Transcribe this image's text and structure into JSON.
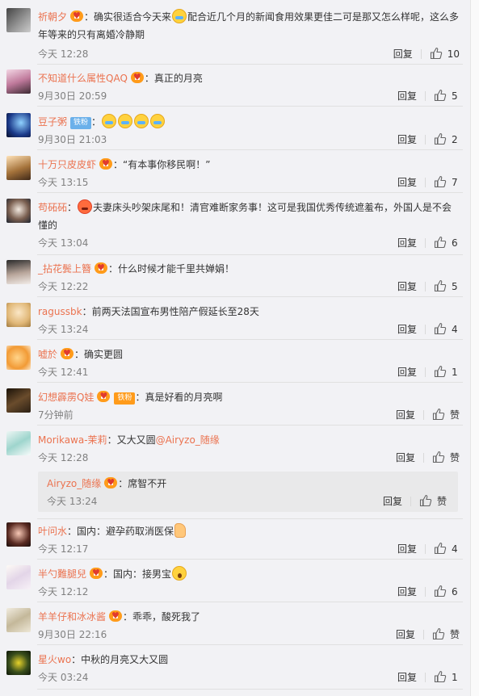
{
  "ui": {
    "reply_label": "回复",
    "like_zero_label": "赞"
  },
  "comments": [
    {
      "user": "祈朝夕",
      "text1": "：确实很适合今天来",
      "text2": "配合近几个月的新闻食用效果更佳二可是那又怎么样呢，这么多年等来的只有离婚冷静期",
      "time": "今天 12:28",
      "likes": "10"
    },
    {
      "user": "不知道什么属性QAQ",
      "text1": "：真正的月亮",
      "time": "9月30日 20:59",
      "likes": "5"
    },
    {
      "user": "豆子粥",
      "badge": "铁粉",
      "text1": "：",
      "time": "9月30日 21:03",
      "likes": "2"
    },
    {
      "user": "十万只皮皮虾",
      "text1": "：“有本事你移民啊！”",
      "time": "今天 13:15",
      "likes": "7"
    },
    {
      "user": "苟砳砳",
      "text1": "：",
      "text2": "夫妻床头吵架床尾和！清官难断家务事！这可是我国优秀传统遮羞布，外国人是不会懂的",
      "time": "今天 13:04",
      "likes": "6"
    },
    {
      "user": "_拈花鬓上簪",
      "text1": "：什么时候才能千里共婵娟！",
      "time": "今天 12:22",
      "likes": "5"
    },
    {
      "user": "ragussbk",
      "text1": "：前两天法国宣布男性陪产假延长至28天",
      "time": "今天 13:24",
      "likes": "4"
    },
    {
      "user": "嘘於",
      "text1": "：确实更圆",
      "time": "今天 12:41",
      "likes": "1"
    },
    {
      "user": "幻想霹雳Q娃",
      "badge": "铁粉",
      "text1": "：真是好看的月亮啊",
      "time": "7分钟前",
      "likes": "赞"
    },
    {
      "user": "Morikawa-茉莉",
      "text1": "：又大又圆",
      "mention": "@Airyzo_随缘",
      "time": "今天 12:28",
      "likes": "赞"
    },
    {
      "user": "叶问水",
      "text1": "：国内：避孕药取消医保",
      "time": "今天 12:17",
      "likes": "4"
    },
    {
      "user": "半勺難腿兒",
      "text1": "：国内：接男宝",
      "time": "今天 12:12",
      "likes": "6"
    },
    {
      "user": "羊羊仔和冰冰酱",
      "text1": "：乖乖，酸死我了",
      "time": "9月30日 22:16",
      "likes": "赞"
    },
    {
      "user": "星火wo",
      "text1": "：中秋的月亮又大又圆",
      "time": "今天 03:24",
      "likes": "1"
    }
  ],
  "subreply": {
    "user": "Airyzo_随缘",
    "text1": "：席智不开",
    "time": "今天 13:24",
    "likes": "赞"
  }
}
